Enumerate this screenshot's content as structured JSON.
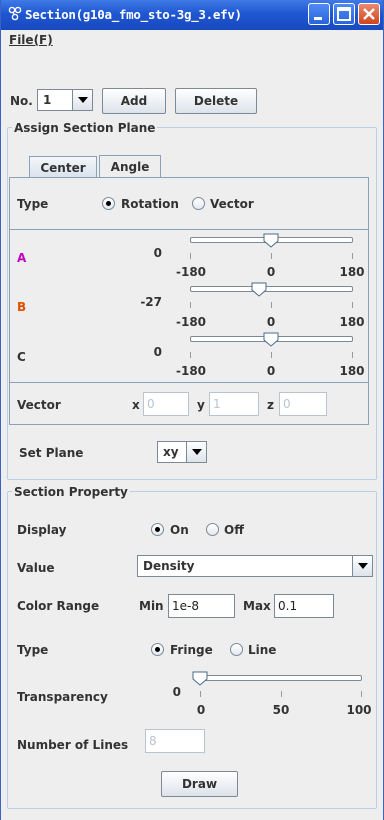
{
  "window": {
    "title": "Section(g10a_fmo_sto-3g_3.efv)",
    "colors": {
      "titlebar": "#2058d4",
      "background": "#eeeeee",
      "label_a": "#c000c0",
      "label_b": "#e05000"
    }
  },
  "menu": {
    "file": "File(F)"
  },
  "top": {
    "no_label": "No.",
    "no_value": "1",
    "add": "Add",
    "delete": "Delete"
  },
  "assign": {
    "title": "Assign Section Plane",
    "tabs": {
      "center": "Center",
      "angle": "Angle",
      "selected": "Angle"
    },
    "type_label": "Type",
    "type_options": {
      "rotation": "Rotation",
      "vector": "Vector",
      "selected": "Rotation"
    },
    "sliders": {
      "a": {
        "label": "A",
        "value": 0,
        "min": "-180",
        "mid": "0",
        "max": "180"
      },
      "b": {
        "label": "B",
        "value": -27,
        "min": "-180",
        "mid": "0",
        "max": "180"
      },
      "c": {
        "label": "C",
        "value": 0,
        "min": "-180",
        "mid": "0",
        "max": "180"
      }
    },
    "vector": {
      "label": "Vector",
      "x_label": "x",
      "x_value": "0",
      "y_label": "y",
      "y_value": "1",
      "z_label": "z",
      "z_value": "0"
    },
    "set_plane_label": "Set Plane",
    "set_plane_value": "xy"
  },
  "property": {
    "title": "Section Property",
    "display_label": "Display",
    "display_on": "On",
    "display_off": "Off",
    "display_selected": "On",
    "value_label": "Value",
    "value_selected": "Density",
    "color_range_label": "Color Range",
    "min_label": "Min",
    "min_value": "1e-8",
    "max_label": "Max",
    "max_value": "0.1",
    "type_label": "Type",
    "type_fringe": "Fringe",
    "type_line": "Line",
    "type_selected": "Fringe",
    "transparency_label": "Transparency",
    "transparency": {
      "value": 0,
      "min": "0",
      "mid": "50",
      "max": "100"
    },
    "lines_label": "Number of Lines",
    "lines_value": "8",
    "draw": "Draw"
  }
}
